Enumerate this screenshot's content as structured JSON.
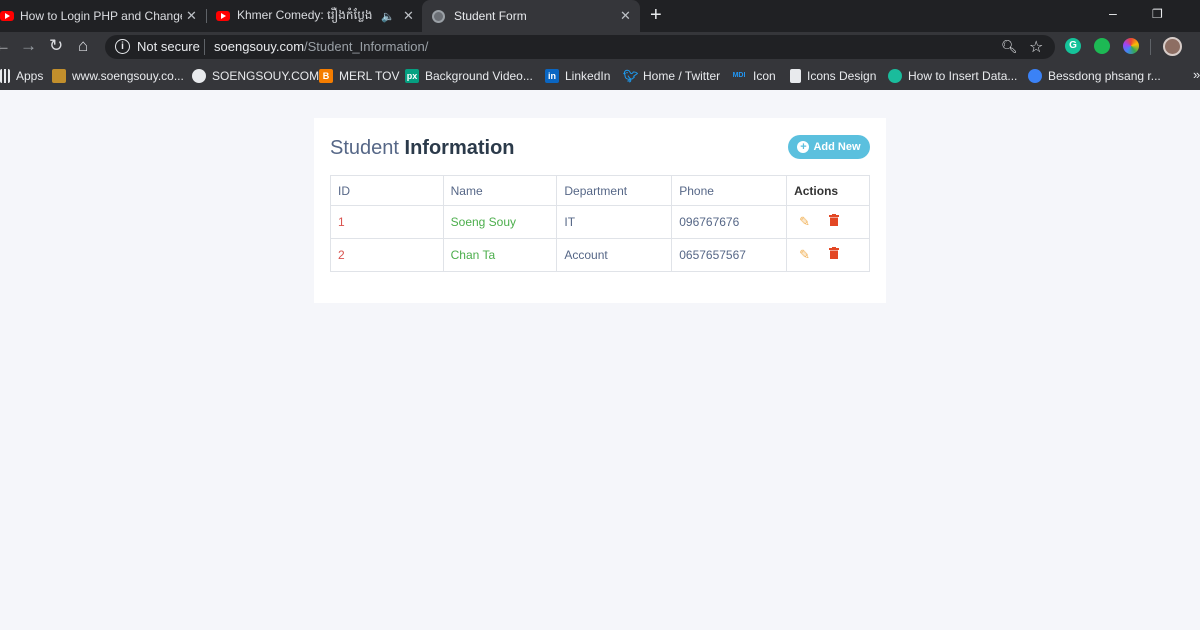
{
  "browser": {
    "tabs": [
      {
        "title": "How to Login PHP and Change M",
        "icon": "youtube-icon"
      },
      {
        "title": "Khmer Comedy: រឿងកំប្លែង",
        "icon": "youtube-icon"
      },
      {
        "title": "Student Form",
        "icon": "globe-icon",
        "active": true
      }
    ],
    "tab_close_glyph": "✕",
    "new_tab_glyph": "+",
    "window_controls": {
      "minimize": "–",
      "restore": "❐",
      "close": "✕"
    },
    "address": {
      "security_label": "Not secure",
      "host": "soengsouy.com",
      "path": "/Student_Information/"
    },
    "bookmarks": [
      {
        "label": "Apps",
        "icon": "apps-grid-icon"
      },
      {
        "label": "www.soengsouy.co...",
        "icon": "site-icon"
      },
      {
        "label": "SOENGSOUY.COM",
        "icon": "globe-icon"
      },
      {
        "label": "MERL TOV",
        "icon": "blogger-icon"
      },
      {
        "label": "Background Video...",
        "icon": "pexels-icon"
      },
      {
        "label": "LinkedIn",
        "icon": "linkedin-icon"
      },
      {
        "label": "Home / Twitter",
        "icon": "twitter-icon"
      },
      {
        "label": "Icon",
        "icon": "mdi-icon"
      },
      {
        "label": "Icons Design",
        "icon": "page-icon"
      },
      {
        "label": "How to Insert Data...",
        "icon": "shield-icon"
      },
      {
        "label": "Bessdong phsang r...",
        "icon": "circle-play-icon"
      }
    ]
  },
  "page": {
    "title_light": "Student ",
    "title_bold": "Information",
    "add_button": "Add New",
    "table": {
      "headers": [
        "ID",
        "Name",
        "Department",
        "Phone",
        "Actions"
      ],
      "rows": [
        {
          "id": "1",
          "name": "Soeng Souy",
          "department": "IT",
          "phone": "096767676"
        },
        {
          "id": "2",
          "name": "Chan Ta",
          "department": "Account",
          "phone": "0657657567"
        }
      ]
    }
  },
  "colors": {
    "accent": "#5bc0de",
    "id_text": "#d9534f",
    "name_text": "#4cae4c",
    "edit_icon": "#f0ad4e",
    "delete_icon": "#e34724"
  }
}
